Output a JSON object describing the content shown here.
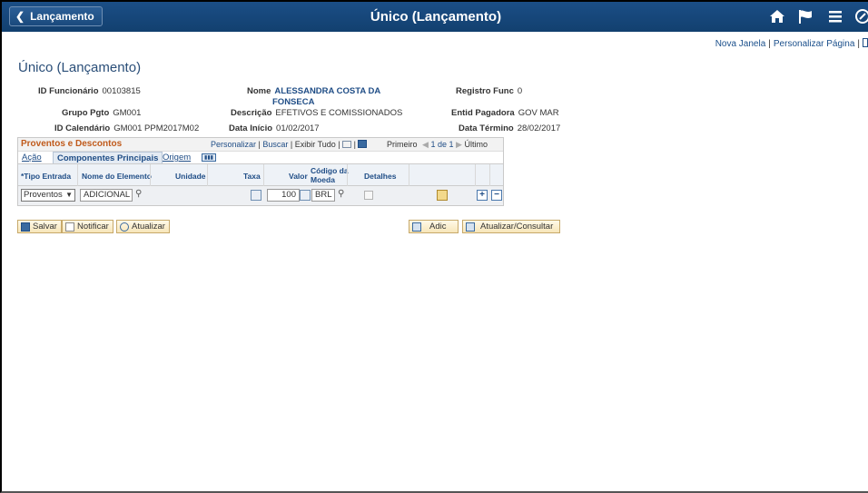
{
  "topbar": {
    "back_label": "Lançamento",
    "title": "Único (Lançamento)",
    "icons": [
      "home-icon",
      "flag-icon",
      "menu-icon",
      "navbar-icon"
    ]
  },
  "links": {
    "new_window": "Nova Janela",
    "customize_page": "Personalizar Página"
  },
  "page": {
    "title": "Único (Lançamento)"
  },
  "fields": {
    "id_funcionario": {
      "label": "ID Funcionário",
      "value": "00103815"
    },
    "nome": {
      "label": "Nome",
      "value_line1": "ALESSANDRA COSTA DA",
      "value_line2": "FONSECA"
    },
    "registro_func": {
      "label": "Registro Func",
      "value": "0"
    },
    "grupo_pgto": {
      "label": "Grupo Pgto",
      "value": "GM001"
    },
    "descricao": {
      "label": "Descrição",
      "value": "EFETIVOS E COMISSIONADOS"
    },
    "entid_pagadora": {
      "label": "Entid Pagadora",
      "value": "GOV MAR"
    },
    "id_calendario": {
      "label": "ID Calendário",
      "value": "GM001 PPM2017M02"
    },
    "data_inicio": {
      "label": "Data Início",
      "value": "01/02/2017"
    },
    "data_termino": {
      "label": "Data Término",
      "value": "28/02/2017"
    }
  },
  "grid": {
    "title": "Proventos e Descontos",
    "personalizar": "Personalizar",
    "buscar": "Buscar",
    "exibir_tudo": "Exibir Tudo",
    "primeiro": "Primeiro",
    "range": "1 de 1",
    "ultimo": "Último",
    "tabs": [
      "Ação",
      "Componentes Principais",
      "Origem"
    ],
    "columns": {
      "tipo_entrada": "*Tipo Entrada",
      "nome_elemento": "Nome do Elemento",
      "unidade": "Unidade",
      "taxa": "Taxa",
      "valor": "Valor",
      "codigo_moeda_1": "Código da",
      "codigo_moeda_2": "Moeda",
      "detalhes": "Detalhes"
    },
    "row": {
      "tipo_entrada": "Proventos",
      "nome_elemento": "ADICIONAL",
      "valor": "100",
      "moeda": "BRL"
    }
  },
  "buttons": {
    "salvar": "Salvar",
    "notificar": "Notificar",
    "atualizar": "Atualizar",
    "adic": "Adic",
    "atualizar_consultar": "Atualizar/Consultar"
  },
  "colors": {
    "topbar": "#1b4e86",
    "link": "#1f4d86",
    "grid_title": "#c05a1b",
    "button_bg": "#f7e6b9"
  }
}
